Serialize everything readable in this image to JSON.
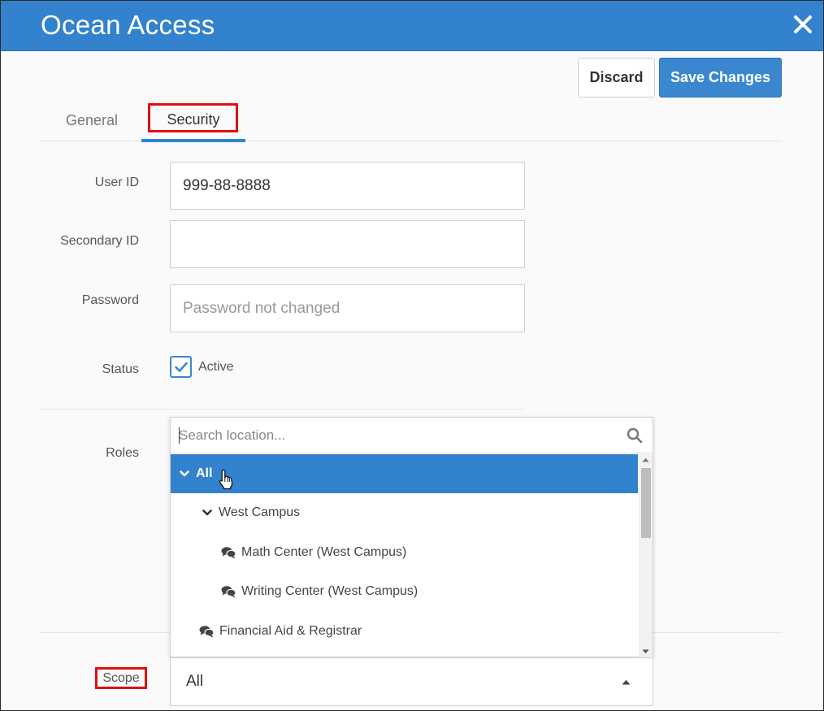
{
  "window": {
    "title": "Ocean Access"
  },
  "toolbar": {
    "discard_label": "Discard",
    "save_label": "Save Changes"
  },
  "tabs": [
    {
      "label": "General"
    },
    {
      "label": "Security"
    }
  ],
  "form": {
    "user_id_label": "User ID",
    "user_id_value": "999-88-8888",
    "secondary_id_label": "Secondary ID",
    "secondary_id_value": "",
    "password_label": "Password",
    "password_placeholder": "Password not changed",
    "status_label": "Status",
    "status_option": "Active",
    "status_checked": true,
    "roles_label": "Roles",
    "scope_label": "Scope",
    "scope_value": "All"
  },
  "location_dropdown": {
    "search_placeholder": "Search location...",
    "items": [
      {
        "label": "All",
        "selected": true,
        "icon": "chevron-down-icon"
      },
      {
        "label": "West Campus",
        "selected": false,
        "icon": "chevron-down-icon"
      },
      {
        "label": "Math Center (West Campus)",
        "selected": false,
        "icon": "comments-icon"
      },
      {
        "label": "Writing Center (West Campus)",
        "selected": false,
        "icon": "comments-icon"
      },
      {
        "label": "Financial Aid & Registrar",
        "selected": false,
        "icon": "comments-icon"
      }
    ]
  },
  "colors": {
    "header": "#3382cd",
    "primary_button": "#3a87d0",
    "selected_item": "#3382cd",
    "highlight_box": "#e01010"
  }
}
